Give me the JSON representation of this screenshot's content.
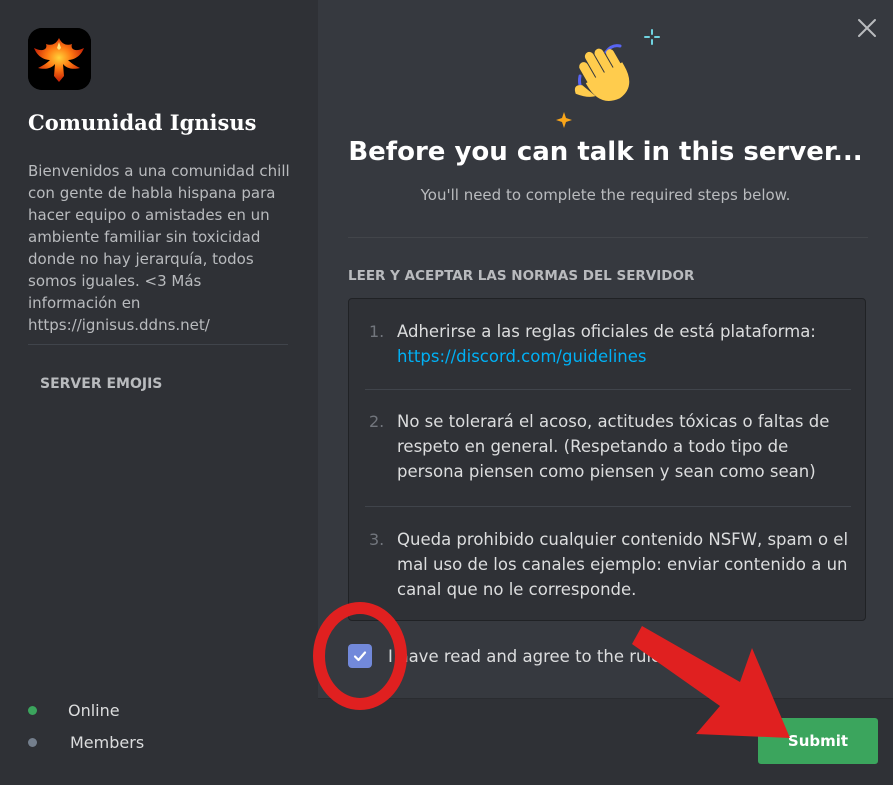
{
  "sidebar": {
    "server_name": "Comunidad Ignisus",
    "description": "Bienvenidos a una comunidad chill con gente de habla hispana para hacer equipo o amistades en un ambiente familiar sin toxicidad donde no hay jerarquía, todos somos iguales. <3 Más información en https://ignisus.ddns.net/",
    "emojis_heading": "SERVER EMOJIS",
    "stats": [
      {
        "label": "Online",
        "color": "#3ba55d"
      },
      {
        "label": "Members",
        "color": "#747f8d"
      }
    ]
  },
  "main": {
    "title": "Before you can talk in this server...",
    "subtitle": "You'll need to complete the required steps below.",
    "rules_heading": "LEER Y ACEPTAR LAS NORMAS DEL SERVIDOR",
    "rules": [
      {
        "number": "1.",
        "text": "Adherirse a las reglas oficiales de está plataforma:",
        "link": "https://discord.com/guidelines"
      },
      {
        "number": "2.",
        "text": "No se tolerará el acoso, actitudes tóxicas o faltas de respeto en general. (Respetando a todo tipo de persona piensen como piensen y sean como sean)"
      },
      {
        "number": "3.",
        "text": "Queda prohibido cualquier contenido NSFW, spam o el mal uso de los canales ejemplo: enviar contenido a un canal que no le corresponde."
      }
    ],
    "agree_label": "I have read and agree to the rules",
    "agree_checked": true,
    "submit_label": "Submit"
  },
  "icons": {
    "close": "close-icon",
    "wave": "waving-hand-icon",
    "checkmark": "checkmark-icon",
    "server": "phoenix-logo"
  },
  "colors": {
    "accent": "#7289da",
    "submit": "#3ba55d",
    "link": "#00b0f4",
    "annotation": "#e02020"
  }
}
